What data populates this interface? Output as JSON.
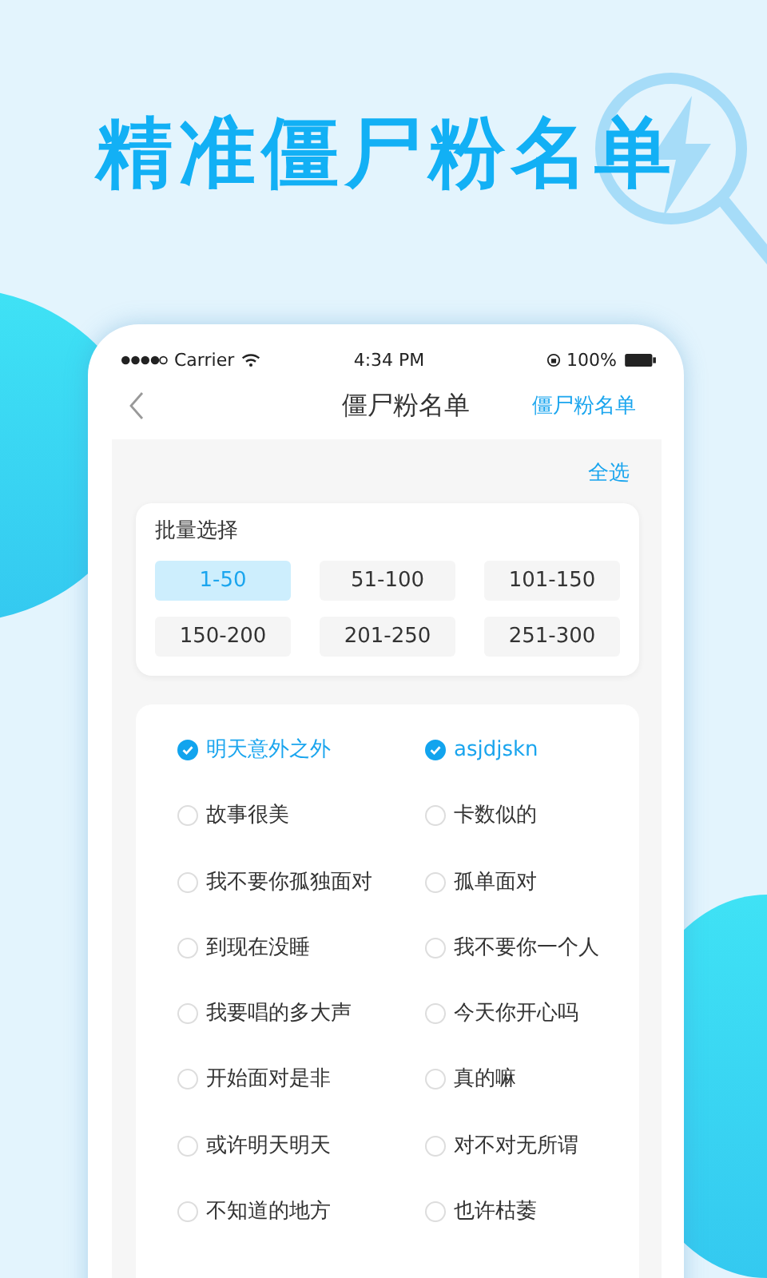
{
  "headline": "精准僵尸粉名单",
  "status_bar": {
    "carrier": "Carrier",
    "time": "4:34 PM",
    "battery": "100%"
  },
  "nav": {
    "title": "僵尸粉名单",
    "action": "僵尸粉名单"
  },
  "select_all": "全选",
  "batch": {
    "title": "批量选择",
    "ranges": [
      {
        "label": "1-50",
        "selected": true
      },
      {
        "label": "51-100",
        "selected": false
      },
      {
        "label": "101-150",
        "selected": false
      },
      {
        "label": "150-200",
        "selected": false
      },
      {
        "label": "201-250",
        "selected": false
      },
      {
        "label": "251-300",
        "selected": false
      }
    ]
  },
  "names": [
    {
      "label": "明天意外之外",
      "checked": true
    },
    {
      "label": "asjdjskn",
      "checked": true
    },
    {
      "label": "故事很美",
      "checked": false
    },
    {
      "label": "卡数似的",
      "checked": false
    },
    {
      "label": "我不要你孤独面对",
      "checked": false
    },
    {
      "label": "孤单面对",
      "checked": false
    },
    {
      "label": "到现在没睡",
      "checked": false
    },
    {
      "label": "我不要你一个人",
      "checked": false
    },
    {
      "label": "我要唱的多大声",
      "checked": false
    },
    {
      "label": "今天你开心吗",
      "checked": false
    },
    {
      "label": "开始面对是非",
      "checked": false
    },
    {
      "label": "真的嘛",
      "checked": false
    },
    {
      "label": "或许明天明天",
      "checked": false
    },
    {
      "label": "对不对无所谓",
      "checked": false
    },
    {
      "label": "不知道的地方",
      "checked": false
    },
    {
      "label": "也许枯萎",
      "checked": false
    }
  ]
}
